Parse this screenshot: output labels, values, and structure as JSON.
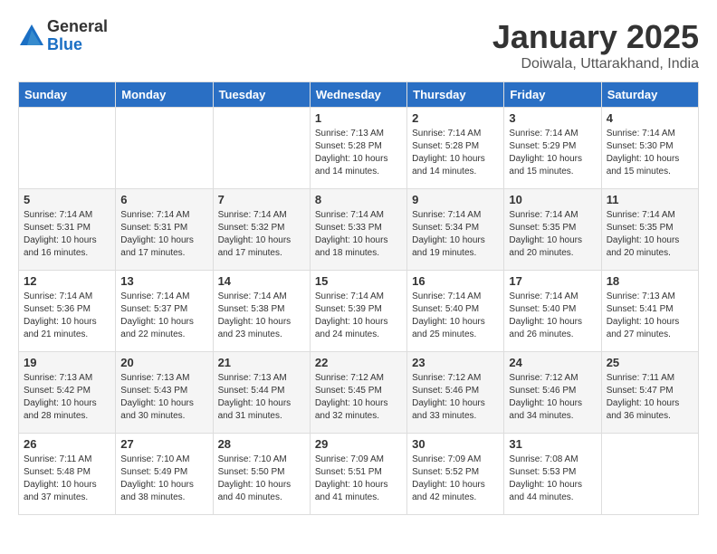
{
  "header": {
    "logo_general": "General",
    "logo_blue": "Blue",
    "month_title": "January 2025",
    "subtitle": "Doiwala, Uttarakhand, India"
  },
  "days_of_week": [
    "Sunday",
    "Monday",
    "Tuesday",
    "Wednesday",
    "Thursday",
    "Friday",
    "Saturday"
  ],
  "weeks": [
    [
      {
        "day": "",
        "info": ""
      },
      {
        "day": "",
        "info": ""
      },
      {
        "day": "",
        "info": ""
      },
      {
        "day": "1",
        "info": "Sunrise: 7:13 AM\nSunset: 5:28 PM\nDaylight: 10 hours\nand 14 minutes."
      },
      {
        "day": "2",
        "info": "Sunrise: 7:14 AM\nSunset: 5:28 PM\nDaylight: 10 hours\nand 14 minutes."
      },
      {
        "day": "3",
        "info": "Sunrise: 7:14 AM\nSunset: 5:29 PM\nDaylight: 10 hours\nand 15 minutes."
      },
      {
        "day": "4",
        "info": "Sunrise: 7:14 AM\nSunset: 5:30 PM\nDaylight: 10 hours\nand 15 minutes."
      }
    ],
    [
      {
        "day": "5",
        "info": "Sunrise: 7:14 AM\nSunset: 5:31 PM\nDaylight: 10 hours\nand 16 minutes."
      },
      {
        "day": "6",
        "info": "Sunrise: 7:14 AM\nSunset: 5:31 PM\nDaylight: 10 hours\nand 17 minutes."
      },
      {
        "day": "7",
        "info": "Sunrise: 7:14 AM\nSunset: 5:32 PM\nDaylight: 10 hours\nand 17 minutes."
      },
      {
        "day": "8",
        "info": "Sunrise: 7:14 AM\nSunset: 5:33 PM\nDaylight: 10 hours\nand 18 minutes."
      },
      {
        "day": "9",
        "info": "Sunrise: 7:14 AM\nSunset: 5:34 PM\nDaylight: 10 hours\nand 19 minutes."
      },
      {
        "day": "10",
        "info": "Sunrise: 7:14 AM\nSunset: 5:35 PM\nDaylight: 10 hours\nand 20 minutes."
      },
      {
        "day": "11",
        "info": "Sunrise: 7:14 AM\nSunset: 5:35 PM\nDaylight: 10 hours\nand 20 minutes."
      }
    ],
    [
      {
        "day": "12",
        "info": "Sunrise: 7:14 AM\nSunset: 5:36 PM\nDaylight: 10 hours\nand 21 minutes."
      },
      {
        "day": "13",
        "info": "Sunrise: 7:14 AM\nSunset: 5:37 PM\nDaylight: 10 hours\nand 22 minutes."
      },
      {
        "day": "14",
        "info": "Sunrise: 7:14 AM\nSunset: 5:38 PM\nDaylight: 10 hours\nand 23 minutes."
      },
      {
        "day": "15",
        "info": "Sunrise: 7:14 AM\nSunset: 5:39 PM\nDaylight: 10 hours\nand 24 minutes."
      },
      {
        "day": "16",
        "info": "Sunrise: 7:14 AM\nSunset: 5:40 PM\nDaylight: 10 hours\nand 25 minutes."
      },
      {
        "day": "17",
        "info": "Sunrise: 7:14 AM\nSunset: 5:40 PM\nDaylight: 10 hours\nand 26 minutes."
      },
      {
        "day": "18",
        "info": "Sunrise: 7:13 AM\nSunset: 5:41 PM\nDaylight: 10 hours\nand 27 minutes."
      }
    ],
    [
      {
        "day": "19",
        "info": "Sunrise: 7:13 AM\nSunset: 5:42 PM\nDaylight: 10 hours\nand 28 minutes."
      },
      {
        "day": "20",
        "info": "Sunrise: 7:13 AM\nSunset: 5:43 PM\nDaylight: 10 hours\nand 30 minutes."
      },
      {
        "day": "21",
        "info": "Sunrise: 7:13 AM\nSunset: 5:44 PM\nDaylight: 10 hours\nand 31 minutes."
      },
      {
        "day": "22",
        "info": "Sunrise: 7:12 AM\nSunset: 5:45 PM\nDaylight: 10 hours\nand 32 minutes."
      },
      {
        "day": "23",
        "info": "Sunrise: 7:12 AM\nSunset: 5:46 PM\nDaylight: 10 hours\nand 33 minutes."
      },
      {
        "day": "24",
        "info": "Sunrise: 7:12 AM\nSunset: 5:46 PM\nDaylight: 10 hours\nand 34 minutes."
      },
      {
        "day": "25",
        "info": "Sunrise: 7:11 AM\nSunset: 5:47 PM\nDaylight: 10 hours\nand 36 minutes."
      }
    ],
    [
      {
        "day": "26",
        "info": "Sunrise: 7:11 AM\nSunset: 5:48 PM\nDaylight: 10 hours\nand 37 minutes."
      },
      {
        "day": "27",
        "info": "Sunrise: 7:10 AM\nSunset: 5:49 PM\nDaylight: 10 hours\nand 38 minutes."
      },
      {
        "day": "28",
        "info": "Sunrise: 7:10 AM\nSunset: 5:50 PM\nDaylight: 10 hours\nand 40 minutes."
      },
      {
        "day": "29",
        "info": "Sunrise: 7:09 AM\nSunset: 5:51 PM\nDaylight: 10 hours\nand 41 minutes."
      },
      {
        "day": "30",
        "info": "Sunrise: 7:09 AM\nSunset: 5:52 PM\nDaylight: 10 hours\nand 42 minutes."
      },
      {
        "day": "31",
        "info": "Sunrise: 7:08 AM\nSunset: 5:53 PM\nDaylight: 10 hours\nand 44 minutes."
      },
      {
        "day": "",
        "info": ""
      }
    ]
  ]
}
